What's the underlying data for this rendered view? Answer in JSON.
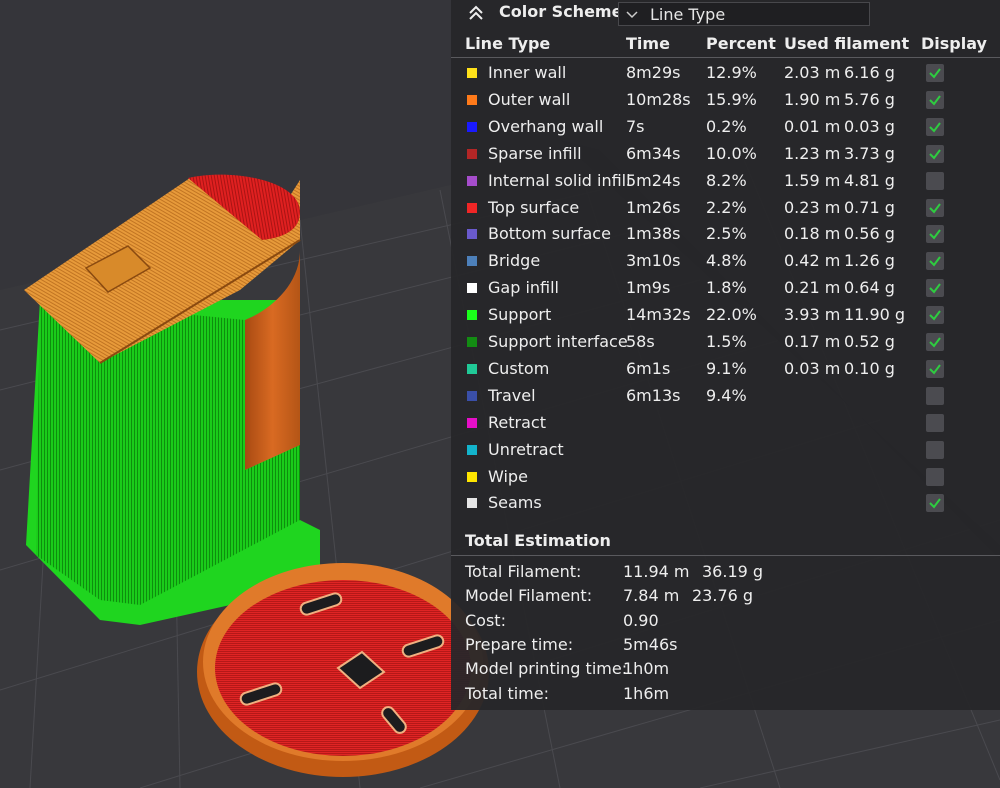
{
  "header": {
    "title": "Color Scheme",
    "scheme_value": "Line Type"
  },
  "table": {
    "columns": [
      "Line Type",
      "Time",
      "Percent",
      "Used filament",
      "Display"
    ],
    "rows": [
      {
        "name": "Inner wall",
        "time": "8m29s",
        "percent": "12.9%",
        "length": "2.03 m",
        "weight": "6.16 g",
        "color": "#ffe11a",
        "display": true
      },
      {
        "name": "Outer wall",
        "time": "10m28s",
        "percent": "15.9%",
        "length": "1.90 m",
        "weight": "5.76 g",
        "color": "#ff7a1a",
        "display": true
      },
      {
        "name": "Overhang wall",
        "time": "7s",
        "percent": "0.2%",
        "length": "0.01 m",
        "weight": "0.03 g",
        "color": "#1a1aff",
        "display": true
      },
      {
        "name": "Sparse infill",
        "time": "6m34s",
        "percent": "10.0%",
        "length": "1.23 m",
        "weight": "3.73 g",
        "color": "#b32626",
        "display": true
      },
      {
        "name": "Internal solid infill",
        "time": "5m24s",
        "percent": "8.2%",
        "length": "1.59 m",
        "weight": "4.81 g",
        "color": "#a64dcc",
        "display": false
      },
      {
        "name": "Top surface",
        "time": "1m26s",
        "percent": "2.2%",
        "length": "0.23 m",
        "weight": "0.71 g",
        "color": "#f02626",
        "display": true
      },
      {
        "name": "Bottom surface",
        "time": "1m38s",
        "percent": "2.5%",
        "length": "0.18 m",
        "weight": "0.56 g",
        "color": "#6a5acd",
        "display": true
      },
      {
        "name": "Bridge",
        "time": "3m10s",
        "percent": "4.8%",
        "length": "0.42 m",
        "weight": "1.26 g",
        "color": "#4d80ba",
        "display": true
      },
      {
        "name": "Gap infill",
        "time": "1m9s",
        "percent": "1.8%",
        "length": "0.21 m",
        "weight": "0.64 g",
        "color": "#ffffff",
        "display": true
      },
      {
        "name": "Support",
        "time": "14m32s",
        "percent": "22.0%",
        "length": "3.93 m",
        "weight": "11.90 g",
        "color": "#1aff1a",
        "display": true
      },
      {
        "name": "Support interface",
        "time": "58s",
        "percent": "1.5%",
        "length": "0.17 m",
        "weight": "0.52 g",
        "color": "#138c13",
        "display": true
      },
      {
        "name": "Custom",
        "time": "6m1s",
        "percent": "9.1%",
        "length": "0.03 m",
        "weight": "0.10 g",
        "color": "#20c997",
        "display": true
      },
      {
        "name": "Travel",
        "time": "6m13s",
        "percent": "9.4%",
        "length": "",
        "weight": "",
        "color": "#3a4fa8",
        "display": false
      },
      {
        "name": "Retract",
        "time": "",
        "percent": "",
        "length": "",
        "weight": "",
        "color": "#e60fc8",
        "display": false
      },
      {
        "name": "Unretract",
        "time": "",
        "percent": "",
        "length": "",
        "weight": "",
        "color": "#13b4cc",
        "display": false
      },
      {
        "name": "Wipe",
        "time": "",
        "percent": "",
        "length": "",
        "weight": "",
        "color": "#ffe600",
        "display": false
      },
      {
        "name": "Seams",
        "time": "",
        "percent": "",
        "length": "",
        "weight": "",
        "color": "#e6e6e6",
        "display": true
      }
    ]
  },
  "total": {
    "title": "Total Estimation",
    "rows": [
      {
        "label": "Total Filament:",
        "value": "11.94 m",
        "value2": "36.19 g"
      },
      {
        "label": "Model Filament:",
        "value": "7.84 m",
        "value2": "23.76 g"
      },
      {
        "label": "Cost:",
        "value": "0.90",
        "value2": ""
      },
      {
        "label": "Prepare time:",
        "value": "5m46s",
        "value2": ""
      },
      {
        "label": "Model printing time:",
        "value": "1h0m",
        "value2": ""
      },
      {
        "label": "Total time:",
        "value": "1h6m",
        "value2": ""
      }
    ]
  },
  "colors": {
    "panel_bg": "#262629",
    "checkbox_bg": "#4b4b50",
    "check_mark": "#2ecc40",
    "support_green": "#1acc1a",
    "wall_orange": "#d2691e",
    "top_red": "#e02020",
    "plate": "#3a3a3e"
  }
}
